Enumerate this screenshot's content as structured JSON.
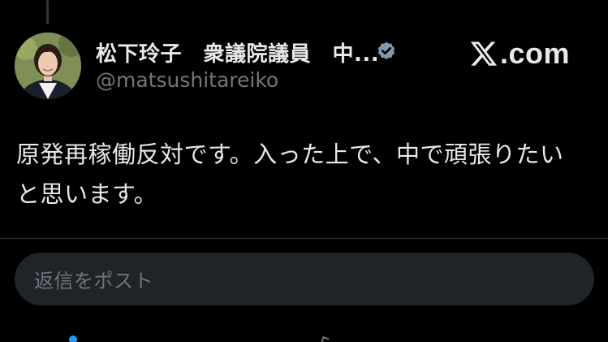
{
  "author": {
    "name": "松下玲子　衆議院議員　中...",
    "handle": "@matsushitareiko",
    "verified_color": "#829aab"
  },
  "site": {
    "label": ".com"
  },
  "post": {
    "text": "原発再稼働反対です。入った上で、中で頑張りたいと思います。"
  },
  "reply": {
    "placeholder": "返信をポスト"
  },
  "colors": {
    "background": "#000000",
    "primary_text": "#e7e9ea",
    "secondary_text": "#71767b",
    "divider": "#2f3336",
    "reply_box": "#202327",
    "accent_blue": "#1d9bf0"
  }
}
